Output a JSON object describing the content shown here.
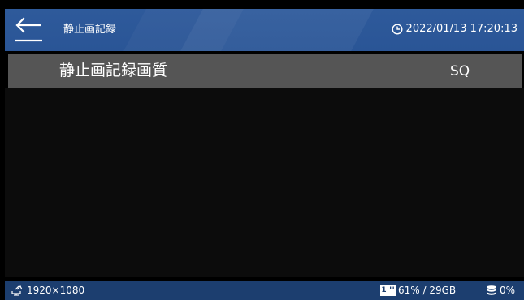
{
  "header": {
    "back_icon": "back-arrow-icon",
    "title": "静止画記録",
    "clock_icon": "clock-icon",
    "datetime": "2022/01/13 17:20:13"
  },
  "menu": {
    "items": [
      {
        "label": "静止画記録画質",
        "value": "SQ"
      }
    ]
  },
  "status_bar": {
    "output_icon": "output-icon",
    "resolution": "1920×1080",
    "slot_number": "1",
    "card_icon": "sd-card-icon",
    "storage": "61% / 29GB",
    "db_icon": "database-icon",
    "db_usage": "0%"
  },
  "colors": {
    "header_bg": "#2a5596",
    "menu_row_bg": "#555555",
    "footer_bg": "#1c3e6f",
    "content_bg": "#0c0c0c"
  }
}
